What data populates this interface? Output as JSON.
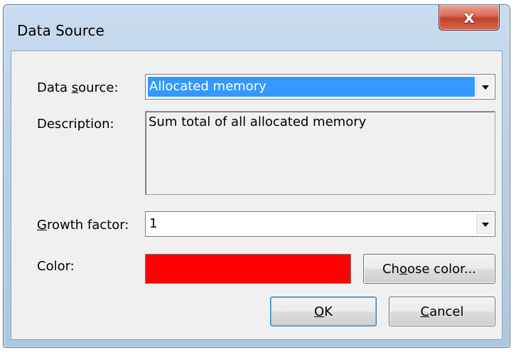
{
  "window": {
    "title": "Data Source",
    "close_label": "x"
  },
  "form": {
    "data_source": {
      "label_pre": "Data ",
      "label_accel": "s",
      "label_post": "ource:",
      "value": "Allocated memory"
    },
    "description": {
      "label": "Description:",
      "value": "Sum total of all allocated memory"
    },
    "growth_factor": {
      "label_accel": "G",
      "label_post": "rowth factor:",
      "value": "1"
    },
    "color": {
      "label": "Color:",
      "swatch_color": "#ff0000"
    }
  },
  "buttons": {
    "choose_color": {
      "pre": "Ch",
      "accel": "o",
      "post": "ose color..."
    },
    "ok": {
      "accel": "O",
      "post": "K"
    },
    "cancel": {
      "accel": "C",
      "post": "ancel"
    }
  },
  "colors": {
    "selection": "#3399ff",
    "close_button": "#c4412b",
    "dialog_face": "#f0f0f0"
  }
}
